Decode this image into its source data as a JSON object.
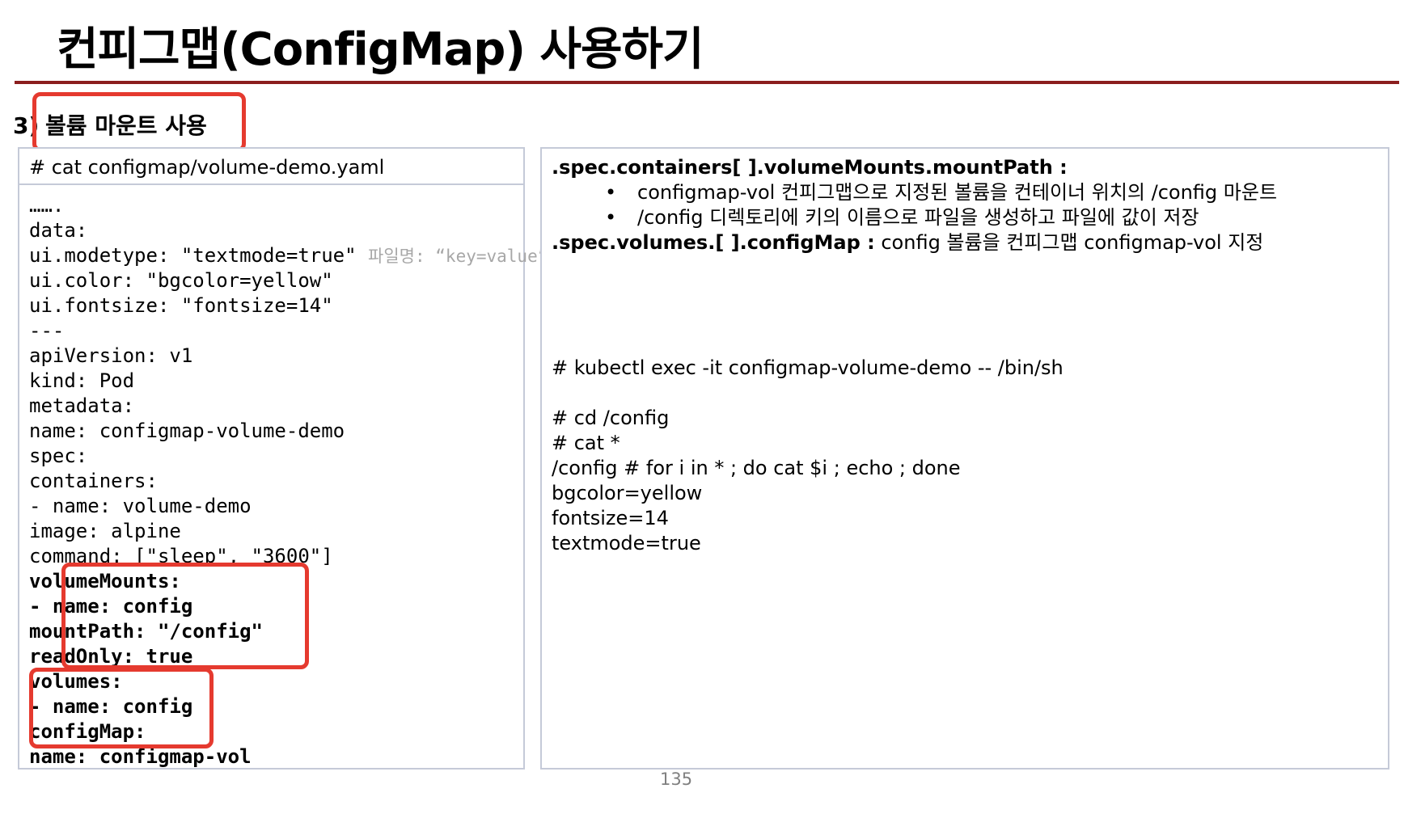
{
  "title": "컨피그맵(ConfigMap) 사용하기",
  "section": {
    "number": "3)",
    "label": "볼륨 마운트 사용"
  },
  "left_panel": {
    "header": "# cat configmap/volume-demo.yaml",
    "lines": {
      "ellipsis": "…….",
      "data": "data:",
      "modetype": "  ui.modetype: \"textmode=true\"",
      "modetype_hint": "파일명: “key=value”",
      "color": "  ui.color: \"bgcolor=yellow\"",
      "fontsize": "  ui.fontsize: \"fontsize=14\"",
      "sep": "---",
      "api": "apiVersion: v1",
      "kind": "kind: Pod",
      "metadata": "metadata:",
      "meta_name": "  name: configmap-volume-demo",
      "spec": "spec:",
      "containers": "  containers:",
      "c_name": "    - name: volume-demo",
      "image": "      image: alpine",
      "command": "      command: [\"sleep\", \"3600\"]",
      "vm": "      volumeMounts:",
      "vm_name": "      - name: config",
      "vm_path": "        mountPath: \"/config\"",
      "vm_ro": "        readOnly: true",
      "volumes": "  volumes:",
      "vol_name": "    - name: config",
      "configmap": "      configMap:",
      "cm_name": "        name: configmap-vol"
    }
  },
  "right_panel": {
    "mountpath_key": ".spec.containers[ ].volumeMounts.mountPath :",
    "bullet_char": "•",
    "bullet1": "configmap-vol 컨피그맵으로 지정된 볼륨을  컨테이너 위치의 /config 마운트",
    "bullet2": "/config 디렉토리에 키의 이름으로 파일을 생성하고 파일에 값이 저장",
    "volumes_key": ".spec.volumes.[ ].configMap :",
    "volumes_desc": " config 볼륨을 컨피그맵 configmap-vol 지정",
    "cmd_exec": "# kubectl exec -it configmap-volume-demo -- /bin/sh",
    "cmd_cd": "# cd /config",
    "cmd_cat": "# cat *",
    "cmd_loop": "/config # for i in * ; do  cat $i ; echo ; done",
    "out1": "bgcolor=yellow",
    "out2": "fontsize=14",
    "out3": "textmode=true"
  },
  "page_number": "135",
  "colors": {
    "title_rule": "#8b1e1e",
    "highlight": "#e53a2f",
    "panel_border": "#c5cad8"
  }
}
